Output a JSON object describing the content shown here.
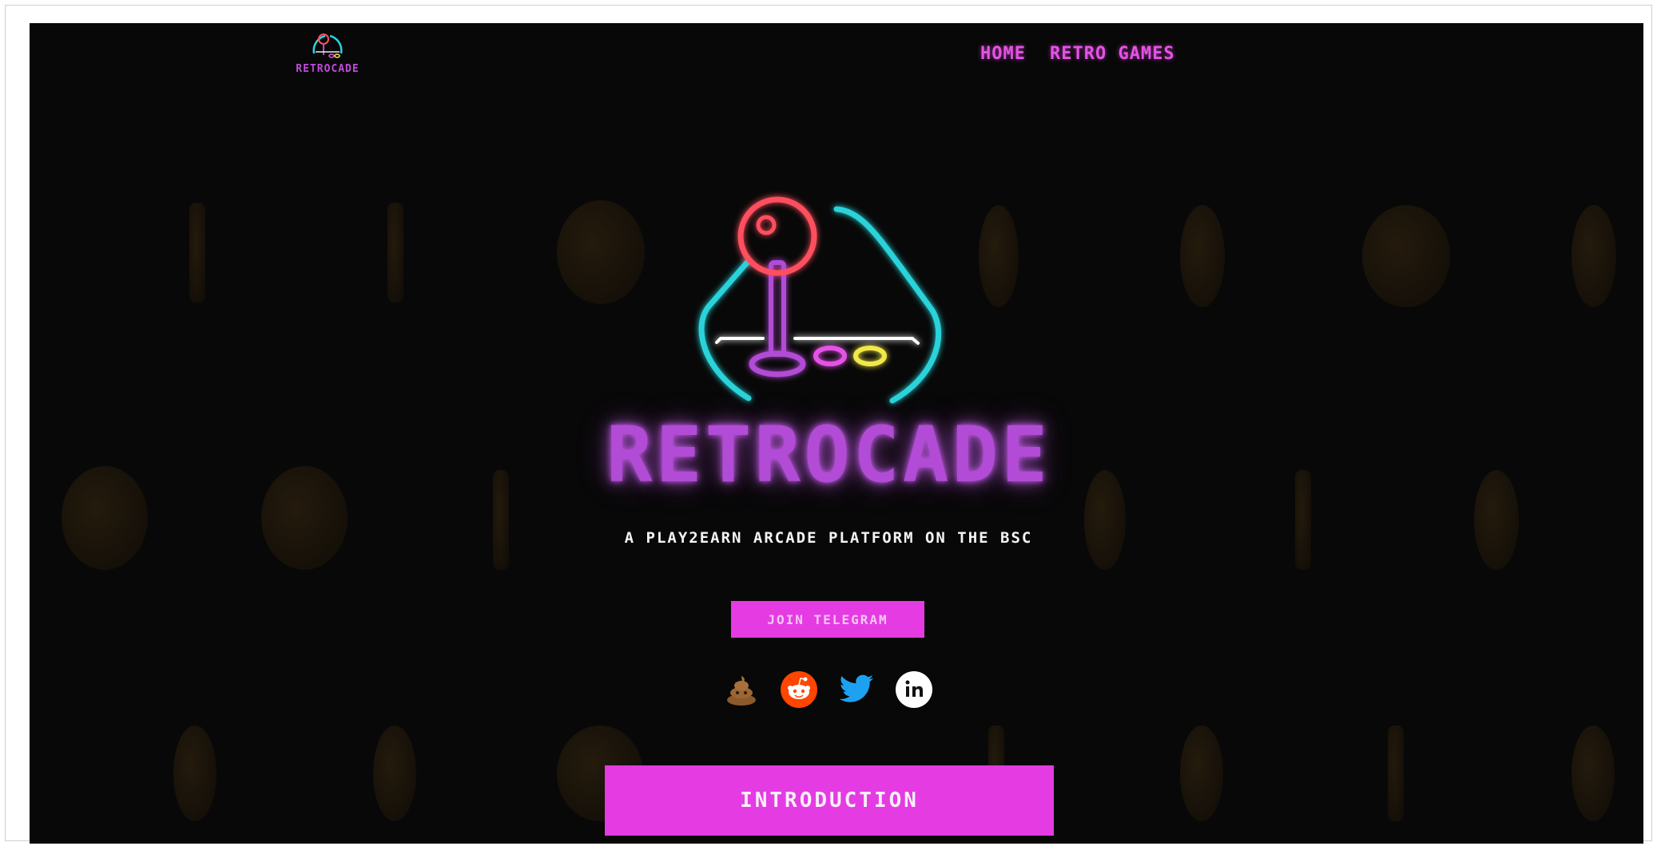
{
  "header": {
    "logo_text": "RETROCADE",
    "nav": [
      {
        "label": "HOME"
      },
      {
        "label": "RETRO GAMES"
      }
    ]
  },
  "hero": {
    "wordmark": "RETROCADE",
    "tagline": "A PLAY2EARN ARCADE PLATFORM ON THE BSC",
    "telegram_button": "JOIN TELEGRAM",
    "socials": [
      {
        "icon": "poop-icon"
      },
      {
        "icon": "reddit-icon"
      },
      {
        "icon": "twitter-icon"
      },
      {
        "icon": "linkedin-icon"
      }
    ],
    "intro_button": "INTRODUCTION"
  },
  "colors": {
    "background": "#080808",
    "accent": "#e43be3",
    "neon_purple": "#b24bd6",
    "neon_cyan": "#2bd3d9",
    "neon_red": "#ff4f5e",
    "neon_yellow": "#f1e84a"
  }
}
